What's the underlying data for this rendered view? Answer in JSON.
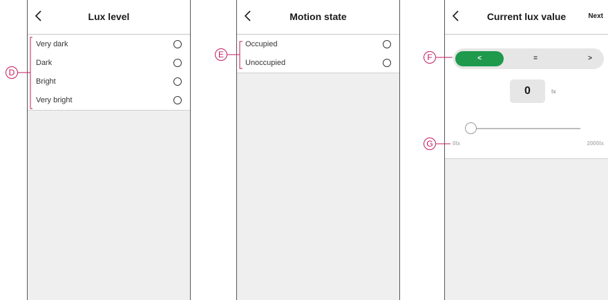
{
  "screens": {
    "lux_level": {
      "title": "Lux level",
      "options": [
        "Very dark",
        "Dark",
        "Bright",
        "Very bright"
      ]
    },
    "motion_state": {
      "title": "Motion state",
      "options": [
        "Occupied",
        "Unoccupied"
      ]
    },
    "current_lux": {
      "title": "Current lux value",
      "next_label": "Next",
      "segments": [
        "<",
        "=",
        ">"
      ],
      "active_segment": "<",
      "value": "0",
      "unit": "lx",
      "slider_min_label": "0lx",
      "slider_max_label": "2000lx",
      "slider_level_fraction": 0
    }
  },
  "annotations": {
    "d": "D",
    "e": "E",
    "f": "F",
    "g": "G"
  },
  "colors": {
    "accent_green": "#1f9a4d",
    "annotation": "#c2185b",
    "screen_background": "#efefef"
  }
}
